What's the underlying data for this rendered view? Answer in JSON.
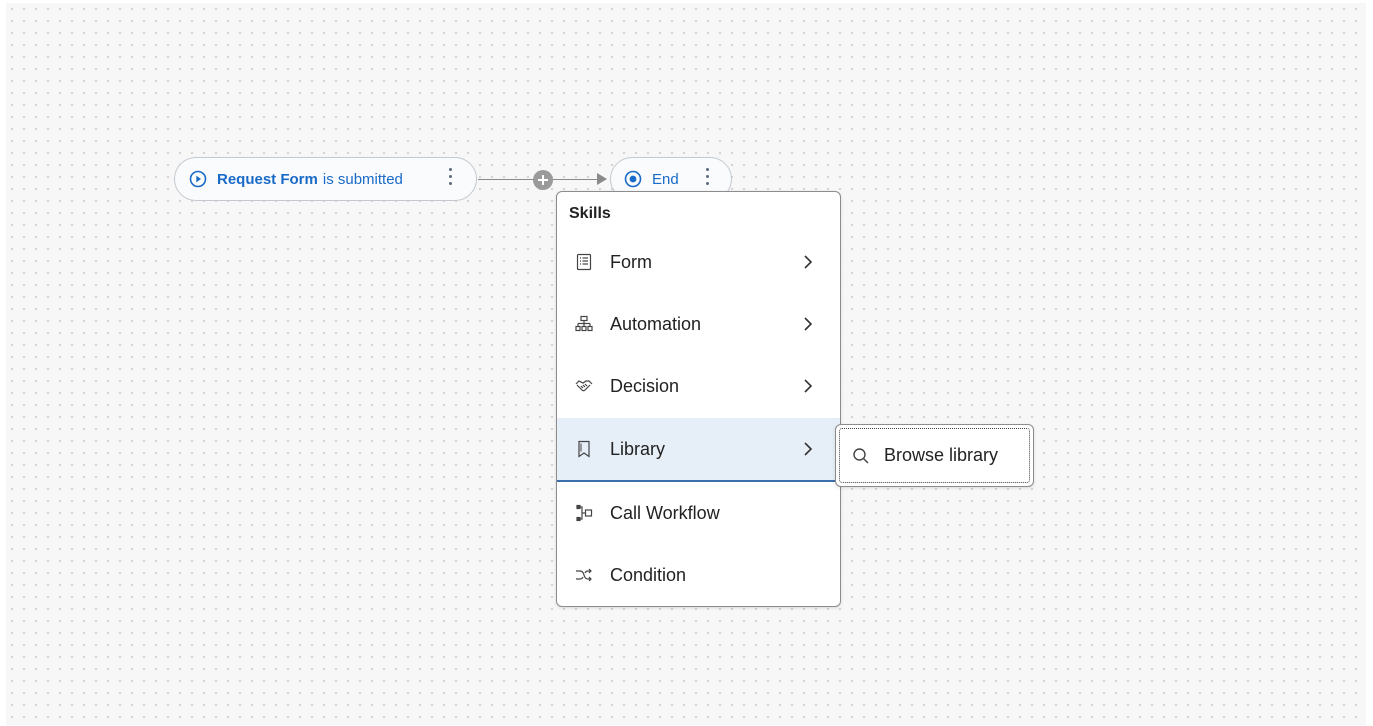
{
  "canvas": {
    "start_node": {
      "bold_text": "Request Form",
      "rest_text": "is submitted",
      "icon": "play-circle-icon",
      "menu_icon": "more-vertical-icon"
    },
    "end_node": {
      "label": "End",
      "icon": "stop-circle-icon",
      "menu_icon": "more-vertical-icon"
    },
    "connector": {
      "add_icon": "add-circle-icon"
    }
  },
  "skills_menu": {
    "title": "Skills",
    "items": [
      {
        "label": "Form",
        "icon": "form-icon",
        "has_submenu": true
      },
      {
        "label": "Automation",
        "icon": "hierarchy-icon",
        "has_submenu": true
      },
      {
        "label": "Decision",
        "icon": "handshake-icon",
        "has_submenu": true
      },
      {
        "label": "Library",
        "icon": "bookmark-icon",
        "has_submenu": true,
        "active": true
      },
      {
        "label": "Call Workflow",
        "icon": "call-workflow-icon",
        "has_submenu": false
      },
      {
        "label": "Condition",
        "icon": "shuffle-icon",
        "has_submenu": false
      }
    ]
  },
  "library_submenu": {
    "items": [
      {
        "label": "Browse library",
        "icon": "search-icon"
      }
    ]
  },
  "colors": {
    "accent": "#1a6ac8",
    "active_bg": "#e6eef8",
    "active_border": "#3a6fae"
  }
}
